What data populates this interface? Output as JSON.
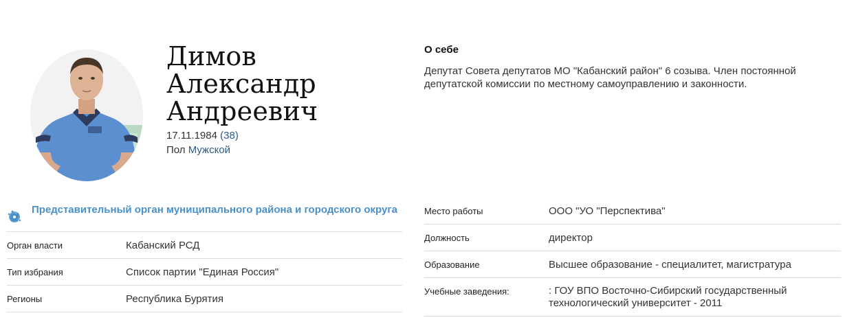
{
  "profile": {
    "name_lines": [
      "Димов",
      "Александр",
      "Андреевич"
    ],
    "birth_date": "17.11.1984",
    "age": "(38)",
    "sex_label": "Пол",
    "sex_value": "Мужской",
    "avatar_icon": "person-photo"
  },
  "about": {
    "title": "О себе",
    "text": "Депутат Совета депутатов МО \"Кабанский район\" 6 созыва. Член постоянной депутатской комиссии по местному самоуправлению и законности."
  },
  "organization": {
    "icon": "district-emblem-icon",
    "title": "Представительный орган муниципального района и городского округа",
    "rows": [
      {
        "label": "Орган власти",
        "value": "Кабанский РСД"
      },
      {
        "label": "Тип избрания",
        "value": "Список партии \"Единая Россия\""
      },
      {
        "label": "Регионы",
        "value": "Республика Бурятия"
      }
    ]
  },
  "details": {
    "rows": [
      {
        "label": "Место работы",
        "value": "ООО \"УО \"Перспектива\""
      },
      {
        "label": "Должность",
        "value": "директор"
      },
      {
        "label": "Образование",
        "value": "Высшее образование - специалитет, магистратура"
      },
      {
        "label": "Учебные заведения:",
        "value": ": ГОУ ВПО Восточно-Сибирский государственный технологический университет - 2011"
      }
    ]
  },
  "colors": {
    "accent": "#4a90c8",
    "link": "#2a5a86",
    "shirt": "#5b8fd0",
    "divider": "#dcdcdc"
  }
}
